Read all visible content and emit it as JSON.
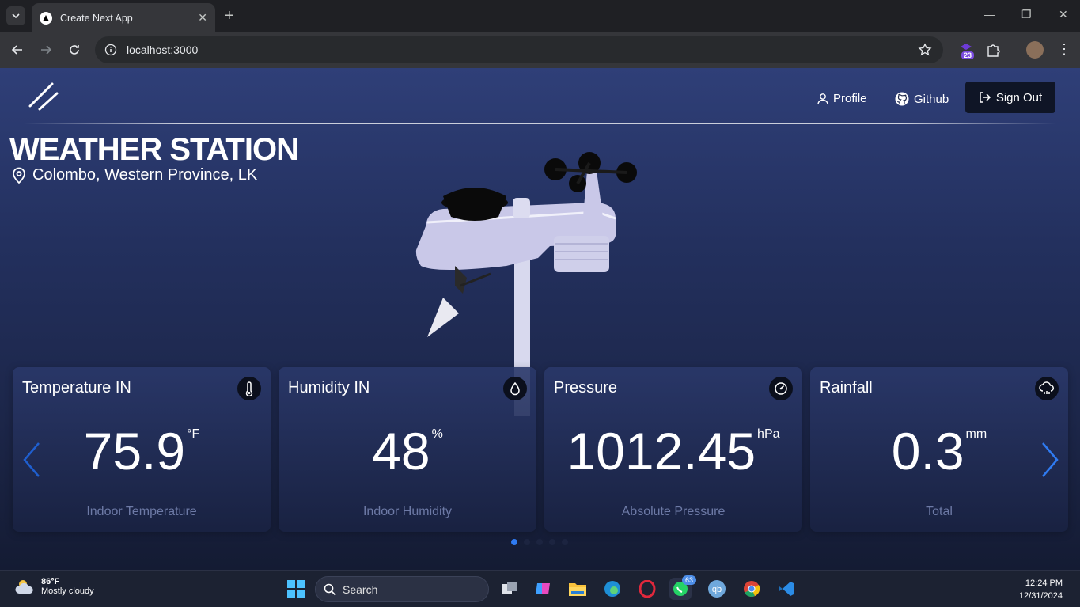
{
  "browser": {
    "tab_title": "Create Next App",
    "url": "localhost:3000",
    "extension_badge": "23"
  },
  "header": {
    "profile_label": "Profile",
    "github_label": "Github",
    "signout_label": "Sign Out"
  },
  "hero": {
    "title": "WEATHER STATION",
    "location": "Colombo, Western Province, LK"
  },
  "cards": [
    {
      "title": "Temperature IN",
      "value": "75.9",
      "unit": "°F",
      "subtitle": "Indoor Temperature",
      "icon": "thermometer-icon"
    },
    {
      "title": "Humidity IN",
      "value": "48",
      "unit": "%",
      "subtitle": "Indoor Humidity",
      "icon": "droplet-icon"
    },
    {
      "title": "Pressure",
      "value": "1012.45",
      "unit": "hPa",
      "subtitle": "Absolute Pressure",
      "icon": "gauge-icon"
    },
    {
      "title": "Rainfall",
      "value": "0.3",
      "unit": "mm",
      "subtitle": "Total",
      "icon": "cloud-rain-icon"
    }
  ],
  "carousel": {
    "page_count": 5,
    "active_index": 0
  },
  "taskbar": {
    "weather_temp": "86°F",
    "weather_desc": "Mostly cloudy",
    "search_label": "Search",
    "whatsapp_badge": "63",
    "time": "12:24 PM",
    "date": "12/31/2024"
  },
  "colors": {
    "accent": "#2f7bf2",
    "page_top": "#2f3f78",
    "page_bottom": "#141b33"
  }
}
